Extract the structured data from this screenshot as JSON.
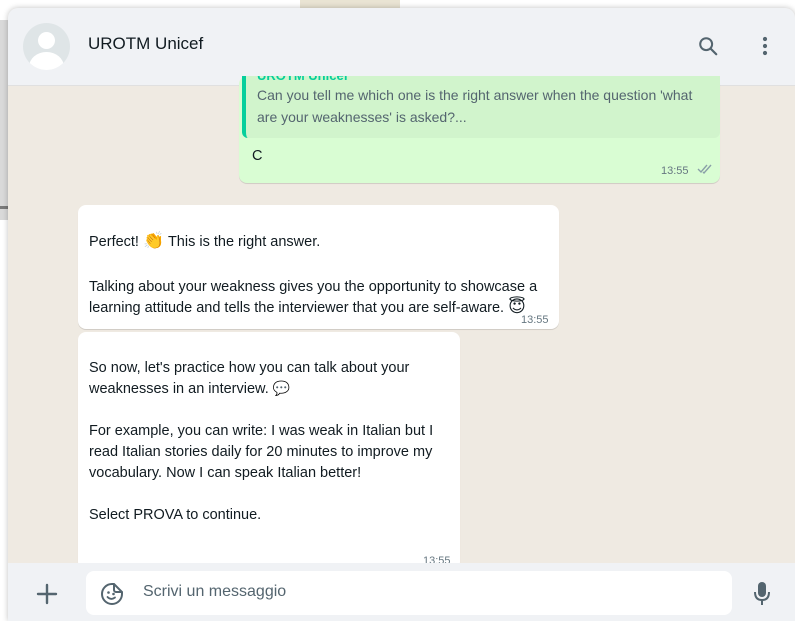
{
  "header": {
    "contact_name": "UROTM Unicef",
    "icons": [
      "avatar",
      "search-icon",
      "more-options-icon"
    ]
  },
  "messages": {
    "outgoing": {
      "quote_author": "UROTM Unicef",
      "quote_text": "Can you tell me which one is the right answer when the question 'what are your weaknesses' is asked?...",
      "text": "C",
      "time": "13:55",
      "status_icon": "double-check-icon"
    },
    "incoming_1": {
      "line1_before": "Perfect! ",
      "emoji1": "👏",
      "line1_after": " This is the right answer.",
      "body": "Talking about your weakness gives you the opportunity to showcase a learning attitude and tells the interviewer that you are self-aware. ",
      "emoji2": "😇",
      "time": "13:55"
    },
    "incoming_2": {
      "text1": "So now, let's practice how you can talk about your weaknesses in an interview. ",
      "emoji": "💬",
      "text2": "For example, you can write: I was weak in Italian but I read Italian stories daily for 20 minutes to improve my vocabulary.  Now I can speak Italian better!\n\nSelect PROVA to continue.",
      "time": "13:55"
    }
  },
  "footer": {
    "placeholder": "Scrivi un messaggio",
    "icons": [
      "plus-icon",
      "sticker-icon",
      "mic-icon"
    ]
  },
  "colors": {
    "header_bg": "#f0f2f5",
    "chat_bg": "#efeae2",
    "outgoing_bubble": "#d9fdd3",
    "incoming_bubble": "#ffffff",
    "quote_accent": "#06cf9c",
    "read_ticks": "#53bdeb"
  }
}
